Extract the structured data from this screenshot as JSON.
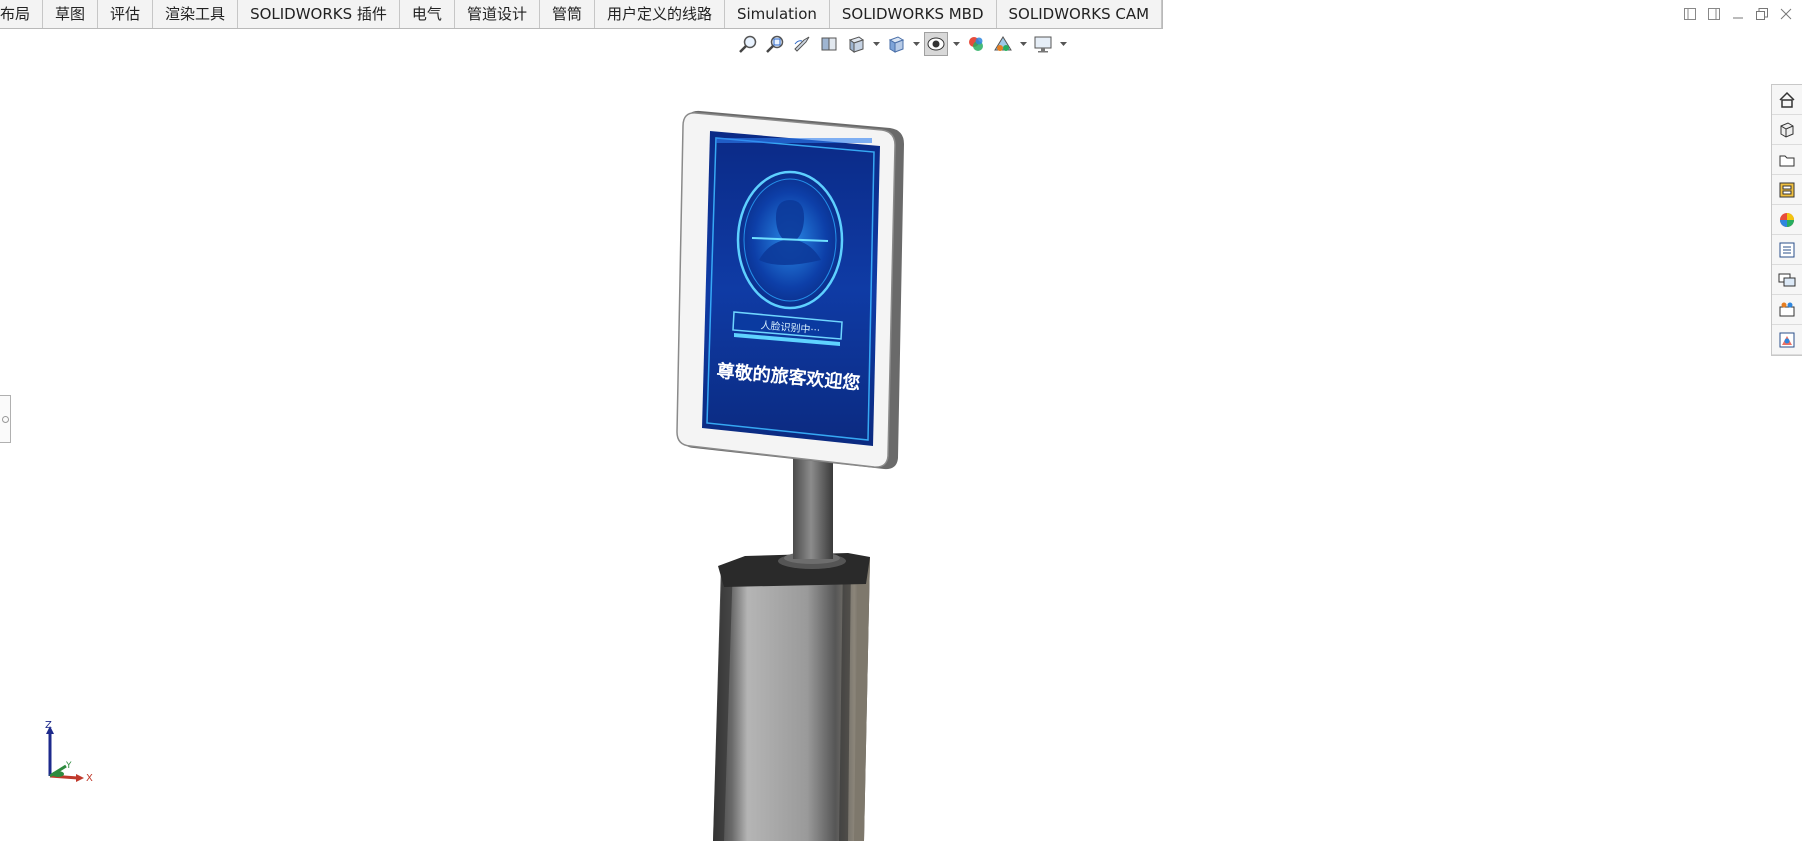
{
  "tabs": [
    "布局",
    "草图",
    "评估",
    "渲染工具",
    "SOLIDWORKS 插件",
    "电气",
    "管道设计",
    "管筒",
    "用户定义的线路",
    "Simulation",
    "SOLIDWORKS MBD",
    "SOLIDWORKS CAM"
  ],
  "view_toolbar": {
    "icons": [
      "zoom-to-fit-icon",
      "zoom-to-area-icon",
      "previous-view-icon",
      "section-view-icon",
      "dynamic-annotation-view-icon",
      "view-orientation-icon",
      "display-style-icon",
      "hide-show-items-icon",
      "edit-appearance-icon",
      "apply-scene-icon",
      "view-settings-icon"
    ],
    "active": "display-style-icon"
  },
  "task_pane": {
    "icons": [
      "home-icon",
      "3d-content-icon",
      "file-explorer-icon",
      "view-palette-icon",
      "appearances-icon",
      "custom-properties-icon",
      "forum-icon",
      "solidworks-resources-icon",
      "design-library-icon"
    ]
  },
  "model": {
    "progress_text": "人脸识别中···",
    "welcome_text": "尊敬的旅客欢迎您",
    "accent": "#0e3b9e",
    "glow": "#37c2ff"
  },
  "triad": {
    "z": "Z",
    "y": "Y",
    "x": "X"
  },
  "colors": {
    "tabbar_bg": "#f3f3f3",
    "accent": "#0e3b9e"
  }
}
